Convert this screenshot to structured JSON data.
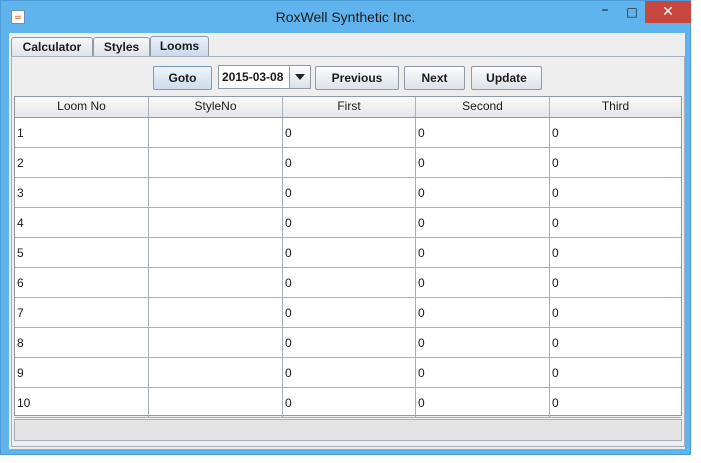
{
  "window": {
    "title": "RoxWell Synthetic Inc.",
    "icon": "java-cup-icon"
  },
  "window_controls": {
    "minimize": "–",
    "maximize": "□",
    "close": "✕"
  },
  "tabs": [
    {
      "label": "Calculator",
      "active": false
    },
    {
      "label": "Styles",
      "active": false
    },
    {
      "label": "Looms",
      "active": true
    }
  ],
  "toolbar": {
    "goto_label": "Goto",
    "date_value": "2015-03-08",
    "previous_label": "Previous",
    "next_label": "Next",
    "update_label": "Update"
  },
  "table": {
    "columns": [
      "Loom No",
      "StyleNo",
      "First",
      "Second",
      "Third"
    ],
    "rows": [
      [
        "1",
        "",
        "0",
        "0",
        "0"
      ],
      [
        "2",
        "",
        "0",
        "0",
        "0"
      ],
      [
        "3",
        "",
        "0",
        "0",
        "0"
      ],
      [
        "4",
        "",
        "0",
        "0",
        "0"
      ],
      [
        "5",
        "",
        "0",
        "0",
        "0"
      ],
      [
        "6",
        "",
        "0",
        "0",
        "0"
      ],
      [
        "7",
        "",
        "0",
        "0",
        "0"
      ],
      [
        "8",
        "",
        "0",
        "0",
        "0"
      ],
      [
        "9",
        "",
        "0",
        "0",
        "0"
      ],
      [
        "10",
        "",
        "0",
        "0",
        "0"
      ]
    ]
  },
  "colors": {
    "titlebar": "#5fb4ee",
    "close_button": "#c7463e",
    "panel": "#eeeeee"
  }
}
